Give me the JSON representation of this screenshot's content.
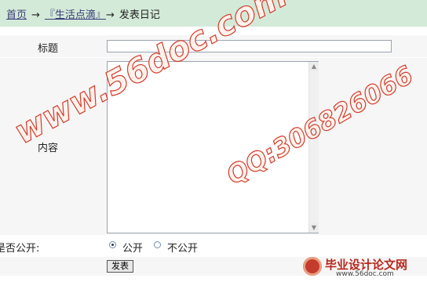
{
  "breadcrumb": {
    "home": "首页",
    "arrow": "→",
    "section": "『生活点滴』",
    "current": "发表日记"
  },
  "form": {
    "title_label": "标题",
    "title_value": "",
    "content_label": "内容",
    "content_value": "",
    "public_label": "是否公开:",
    "options": [
      "公开",
      "不公开"
    ],
    "selected": "公开",
    "submit_label": "发表"
  },
  "watermarks": {
    "site": "www.56doc.com",
    "qq": "QQ:306826066",
    "brand_name": "毕业设计论文网",
    "brand_url": "www.56doc.com"
  },
  "colors": {
    "breadcrumb_bg": "#d3ead8",
    "watermark_red": "#d23c2c"
  }
}
